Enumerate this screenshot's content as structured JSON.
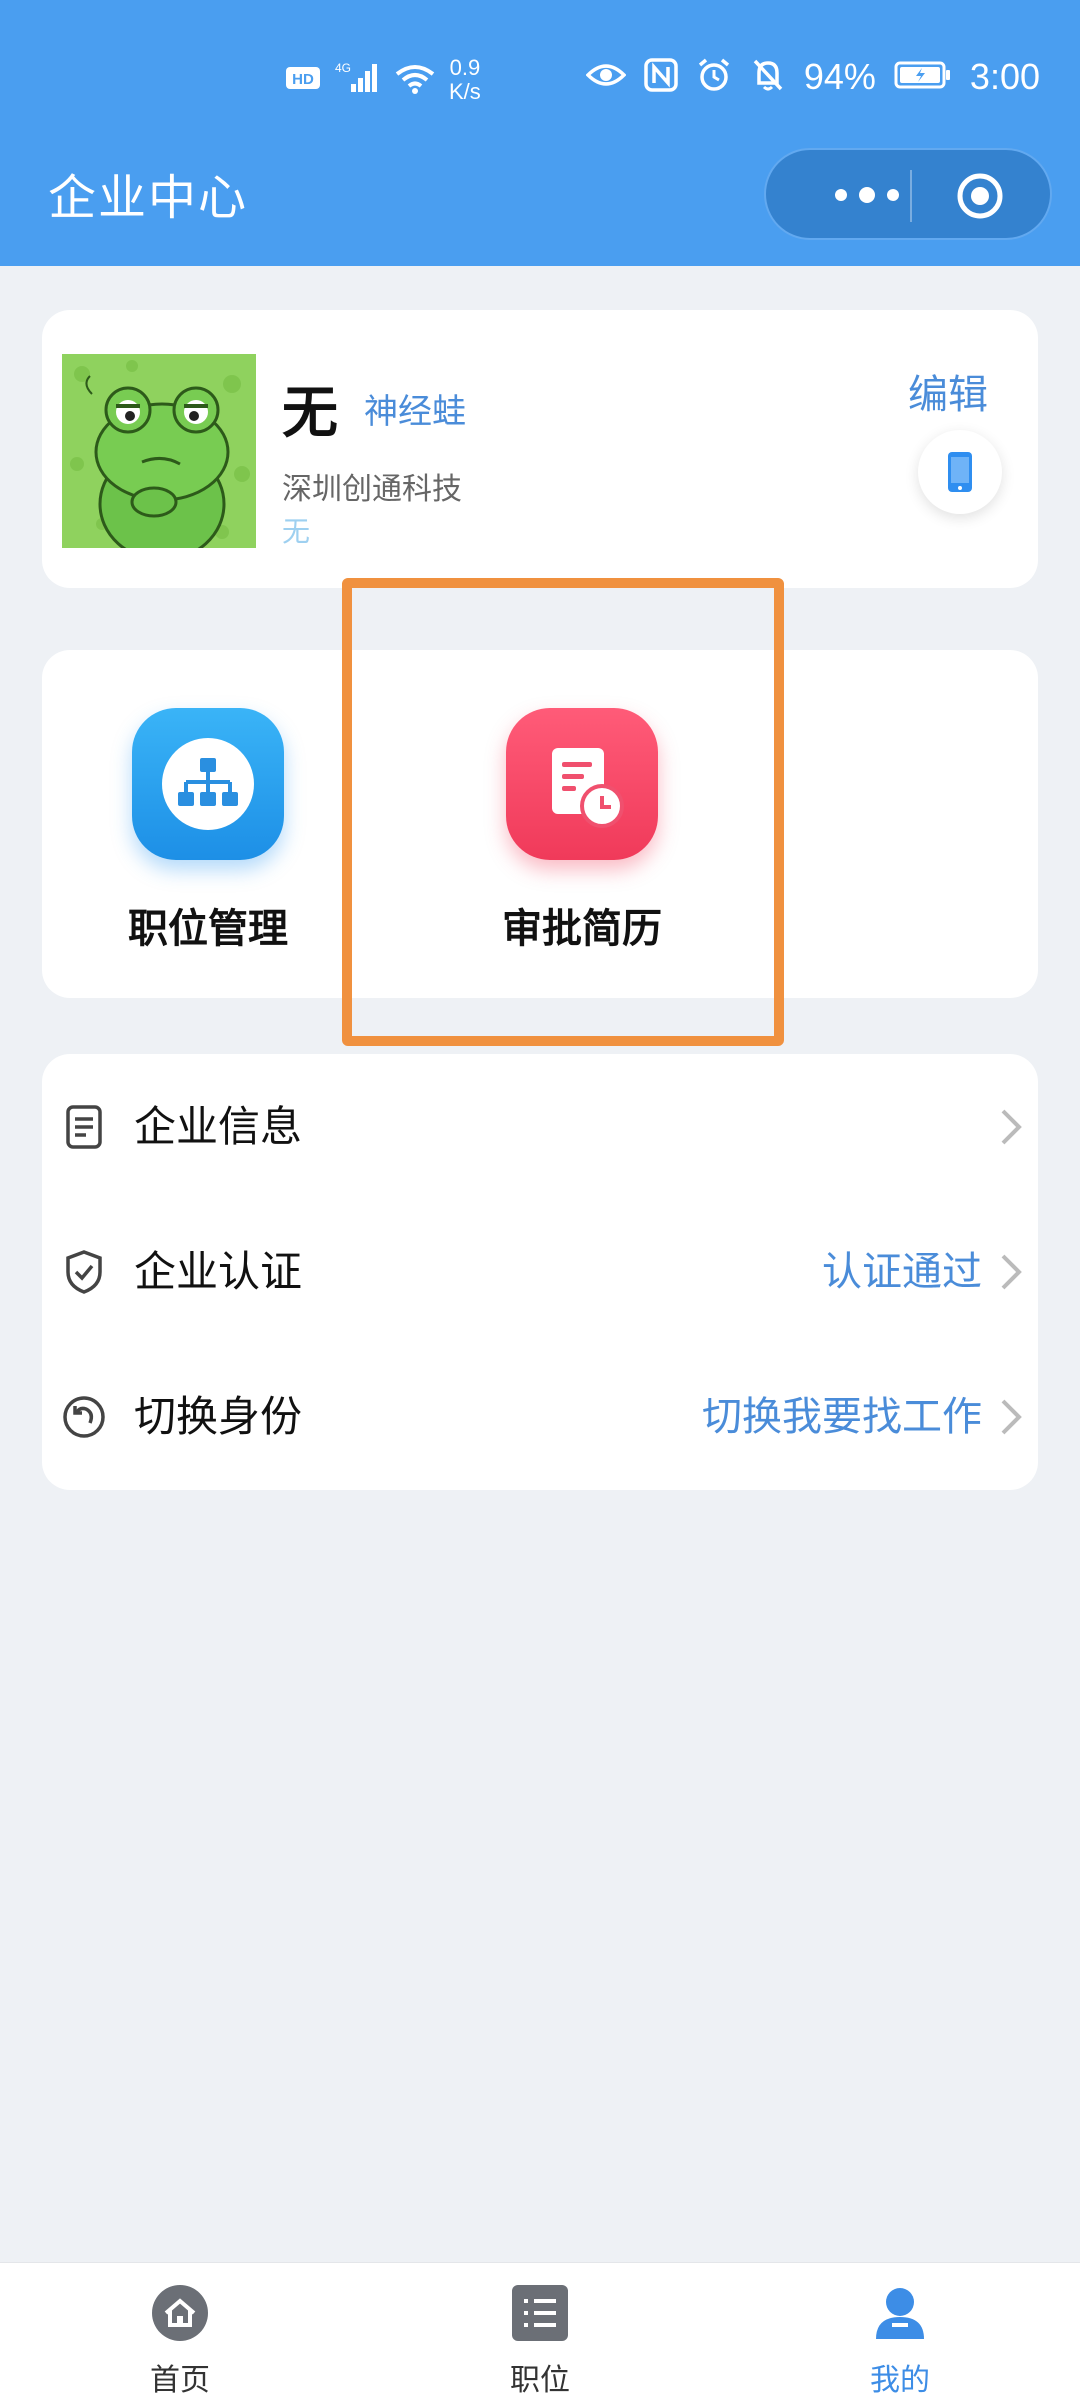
{
  "status_bar": {
    "network_badge": "HD",
    "signal": "4G",
    "speed_value": "0.9",
    "speed_unit": "K/s",
    "battery": "94%",
    "time": "3:00"
  },
  "header": {
    "title": "企业中心",
    "icons": [
      "more-icon",
      "target-icon"
    ]
  },
  "profile": {
    "name": "无",
    "nickname": "神经蛙",
    "company": "深圳创通科技",
    "subtext": "无",
    "edit_label": "编辑",
    "icons": [
      "frog-avatar",
      "phone-icon"
    ]
  },
  "shortcuts": [
    {
      "label": "职位管理",
      "icon": "org-chart-icon",
      "color": "#2a9ff0"
    },
    {
      "label": "审批简历",
      "icon": "document-clock-icon",
      "color": "#f54465"
    }
  ],
  "highlight_color": "#f0913f",
  "menu": [
    {
      "label": "企业信息",
      "value": "",
      "icon": "document-icon"
    },
    {
      "label": "企业认证",
      "value": "认证通过",
      "icon": "shield-check-icon"
    },
    {
      "label": "切换身份",
      "value": "切换我要找工作",
      "icon": "switch-icon"
    }
  ],
  "tabbar": [
    {
      "label": "首页",
      "icon": "home-icon",
      "active": false
    },
    {
      "label": "职位",
      "icon": "list-icon",
      "active": false
    },
    {
      "label": "我的",
      "icon": "user-icon",
      "active": true
    }
  ],
  "colors": {
    "primary": "#4a9ef0",
    "link": "#4a8cd9",
    "background": "#eef1f5"
  }
}
